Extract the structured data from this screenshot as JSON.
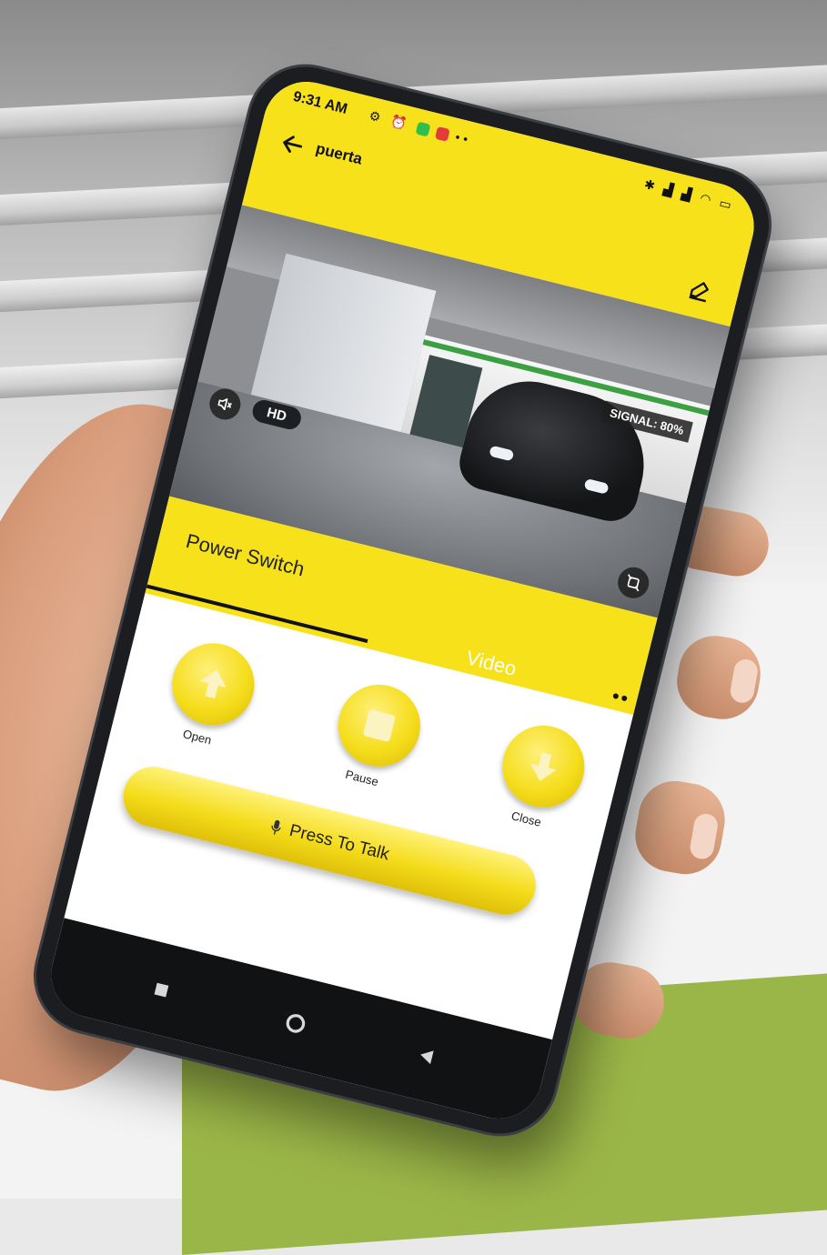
{
  "status_bar": {
    "time": "9:31 AM",
    "left_icons": [
      "settings-icon",
      "alarm-icon",
      "whatsapp-icon",
      "record-icon",
      "more-dots-icon"
    ],
    "right_icons": [
      "bluetooth-icon",
      "signal-icon",
      "signal-icon",
      "wifi-icon",
      "battery-icon"
    ]
  },
  "app_bar": {
    "title": "puerta",
    "back_icon": "arrow-left-icon",
    "edit_icon": "edit-pencil-icon",
    "color": "#f7e11a"
  },
  "video": {
    "signal_text": "SIGNAL: 80%",
    "quality_label": "HD"
  },
  "tabs": [
    {
      "label": "Power Switch",
      "active": true
    },
    {
      "label": "Video",
      "active": false
    }
  ],
  "tabs_more": "••",
  "controls": {
    "open_label": "Open",
    "pause_label": "Pause",
    "close_label": "Close",
    "talk_label": "Press To Talk"
  },
  "colors": {
    "accent": "#f7e11a",
    "background_green": "#9bb648"
  }
}
